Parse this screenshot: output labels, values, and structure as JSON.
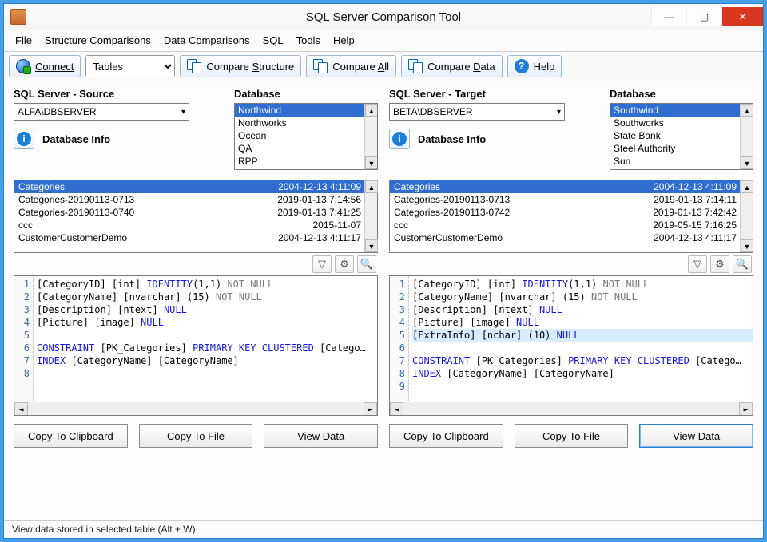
{
  "title": "SQL Server Comparison Tool",
  "menu": {
    "file": "File",
    "structure": "Structure Comparisons",
    "data": "Data Comparisons",
    "sql": "SQL",
    "tools": "Tools",
    "help": "Help"
  },
  "toolbar": {
    "connect": "Connect",
    "object_type": "Tables",
    "compare_structure_pre": "Compare ",
    "compare_structure_u": "S",
    "compare_structure_post": "tructure",
    "compare_all_pre": "Compare ",
    "compare_all_u": "A",
    "compare_all_post": "ll",
    "compare_data_pre": "Compare ",
    "compare_data_u": "D",
    "compare_data_post": "ata",
    "help": "Help"
  },
  "labels": {
    "source_server": "SQL Server - Source",
    "target_server": "SQL Server - Target",
    "database": "Database",
    "db_info": "Database Info",
    "copy_clipboard_pre": "C",
    "copy_clipboard_u": "o",
    "copy_clipboard_post": "py To Clipboard",
    "copy_file_pre": "Copy To ",
    "copy_file_u": "F",
    "copy_file_post": "ile",
    "view_data_u": "V",
    "view_data_post": "iew Data"
  },
  "source": {
    "server": "ALFA\\DBSERVER",
    "databases": [
      "Northwind",
      "Northworks",
      "Ocean",
      "QA",
      "RPP"
    ],
    "databases_selected": 0,
    "tables": [
      {
        "name": "Categories",
        "date": "2004-12-13 4:11:09",
        "sel": true
      },
      {
        "name": "Categories-20190113-0713",
        "date": "2019-01-13 7:14:56"
      },
      {
        "name": "Categories-20190113-0740",
        "date": "2019-01-13 7:41:25"
      },
      {
        "name": "ccc",
        "date": "2015-11-07"
      },
      {
        "name": "CustomerCustomerDemo",
        "date": "2004-12-13 4:11:17"
      }
    ],
    "code": [
      {
        "n": 1,
        "parts": [
          {
            "t": "[CategoryID] [int] "
          },
          {
            "t": "IDENTITY",
            "c": "kw"
          },
          {
            "t": "(1,1) "
          },
          {
            "t": "NOT NULL",
            "c": "gray"
          }
        ]
      },
      {
        "n": 2,
        "parts": [
          {
            "t": "[CategoryName] [nvarchar] (15) "
          },
          {
            "t": "NOT NULL",
            "c": "gray"
          }
        ]
      },
      {
        "n": 3,
        "parts": [
          {
            "t": "[Description] [ntext] "
          },
          {
            "t": "NULL",
            "c": "kw"
          }
        ]
      },
      {
        "n": 4,
        "parts": [
          {
            "t": "[Picture] [image] "
          },
          {
            "t": "NULL",
            "c": "kw"
          }
        ]
      },
      {
        "n": 5,
        "parts": []
      },
      {
        "n": 6,
        "parts": [
          {
            "t": "CONSTRAINT",
            "c": "kw"
          },
          {
            "t": " [PK_Categories] "
          },
          {
            "t": "PRIMARY KEY CLUSTERED",
            "c": "kw"
          },
          {
            "t": "  [Catego…"
          }
        ]
      },
      {
        "n": 7,
        "parts": [
          {
            "t": "INDEX",
            "c": "kw"
          },
          {
            "t": " [CategoryName]  [CategoryName]"
          }
        ]
      },
      {
        "n": 8,
        "parts": []
      }
    ]
  },
  "target": {
    "server": "BETA\\DBSERVER",
    "databases": [
      "Southwind",
      "Southworks",
      "State Bank",
      "Steel Authority",
      "Sun"
    ],
    "databases_selected": 0,
    "tables": [
      {
        "name": "Categories",
        "date": "2004-12-13 4:11:09",
        "sel": true
      },
      {
        "name": "Categories-20190113-0713",
        "date": "2019-01-13 7:14:11"
      },
      {
        "name": "Categories-20190113-0742",
        "date": "2019-01-13 7:42:42"
      },
      {
        "name": "ccc",
        "date": "2019-05-15 7:16:25"
      },
      {
        "name": "CustomerCustomerDemo",
        "date": "2004-12-13 4:11:17"
      }
    ],
    "code": [
      {
        "n": 1,
        "parts": [
          {
            "t": "[CategoryID] [int] "
          },
          {
            "t": "IDENTITY",
            "c": "kw"
          },
          {
            "t": "(1,1) "
          },
          {
            "t": "NOT NULL",
            "c": "gray"
          }
        ]
      },
      {
        "n": 2,
        "parts": [
          {
            "t": "[CategoryName] [nvarchar] (15) "
          },
          {
            "t": "NOT NULL",
            "c": "gray"
          }
        ]
      },
      {
        "n": 3,
        "parts": [
          {
            "t": "[Description] [ntext] "
          },
          {
            "t": "NULL",
            "c": "kw"
          }
        ]
      },
      {
        "n": 4,
        "parts": [
          {
            "t": "[Picture] [image] "
          },
          {
            "t": "NULL",
            "c": "kw"
          }
        ]
      },
      {
        "n": 5,
        "hl": true,
        "parts": [
          {
            "t": "[ExtraInfo] [nchar] (10) "
          },
          {
            "t": "NULL",
            "c": "kw"
          }
        ]
      },
      {
        "n": 6,
        "parts": []
      },
      {
        "n": 7,
        "parts": [
          {
            "t": "CONSTRAINT",
            "c": "kw"
          },
          {
            "t": " [PK_Categories] "
          },
          {
            "t": "PRIMARY KEY CLUSTERED",
            "c": "kw"
          },
          {
            "t": "  [Catego…"
          }
        ]
      },
      {
        "n": 8,
        "parts": [
          {
            "t": "INDEX",
            "c": "kw"
          },
          {
            "t": " [CategoryName]  [CategoryName]"
          }
        ]
      },
      {
        "n": 9,
        "parts": []
      }
    ]
  },
  "status": "View data stored in selected table (Alt + W)"
}
